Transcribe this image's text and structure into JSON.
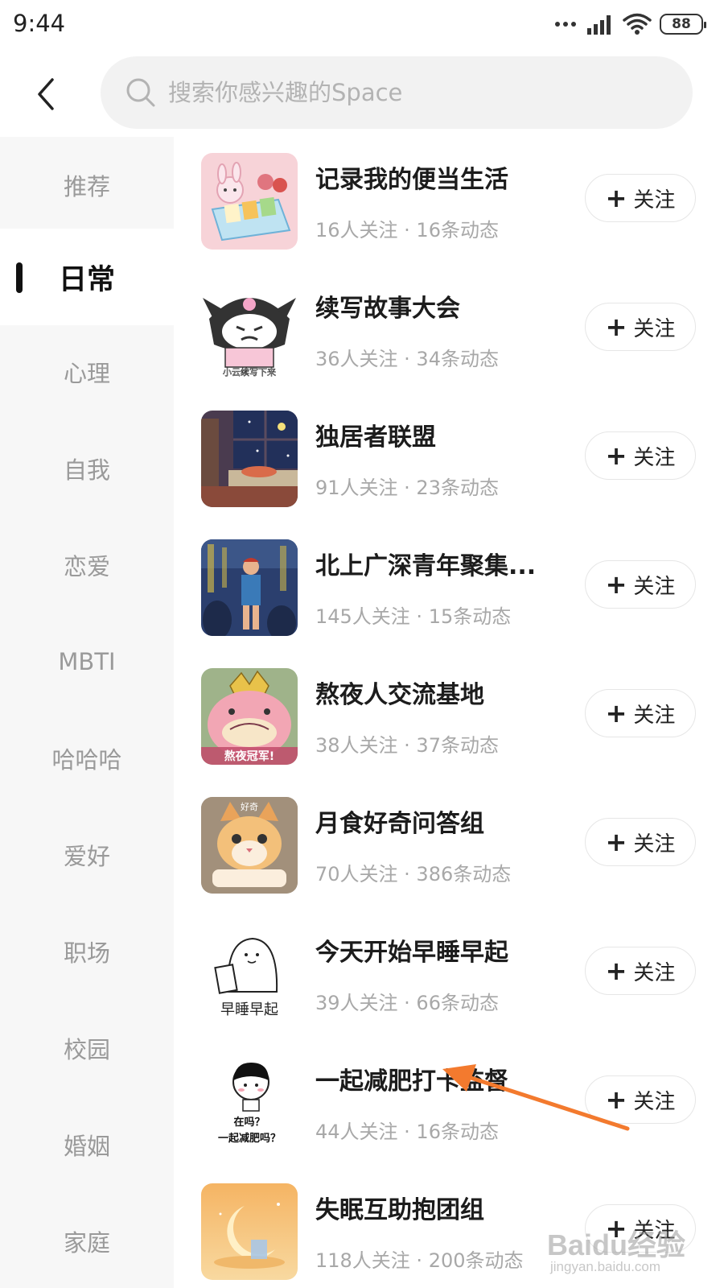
{
  "status_bar": {
    "time": "9:44",
    "battery": "88",
    "icons": [
      "signal-dots-icon",
      "cellular-signal-icon",
      "wifi-icon",
      "battery-icon"
    ]
  },
  "header": {
    "back_icon": "chevron-left-icon",
    "search_icon": "search-icon",
    "search_placeholder": "搜索你感兴趣的Space"
  },
  "sidebar": {
    "items": [
      {
        "label": "推荐",
        "active": false
      },
      {
        "label": "日常",
        "active": true
      },
      {
        "label": "心理",
        "active": false
      },
      {
        "label": "自我",
        "active": false
      },
      {
        "label": "恋爱",
        "active": false
      },
      {
        "label": "MBTI",
        "active": false
      },
      {
        "label": "哈哈哈",
        "active": false
      },
      {
        "label": "爱好",
        "active": false
      },
      {
        "label": "职场",
        "active": false
      },
      {
        "label": "校园",
        "active": false
      },
      {
        "label": "婚姻",
        "active": false
      },
      {
        "label": "家庭",
        "active": false
      }
    ]
  },
  "follow_label": "关注",
  "spaces": [
    {
      "title": "记录我的便当生活",
      "meta": "16人关注 · 16条动态"
    },
    {
      "title": "续写故事大会",
      "meta": "36人关注 · 34条动态",
      "image_text": "小云续写下来"
    },
    {
      "title": "独居者联盟",
      "meta": "91人关注 · 23条动态"
    },
    {
      "title": "北上广深青年聚集...",
      "meta": "145人关注 · 15条动态"
    },
    {
      "title": "熬夜人交流基地",
      "meta": "38人关注 · 37条动态",
      "image_text": "熬夜冠军!"
    },
    {
      "title": "月食好奇问答组",
      "meta": "70人关注 · 386条动态",
      "image_text": "好奇"
    },
    {
      "title": "今天开始早睡早起",
      "meta": "39人关注 · 66条动态",
      "image_text": "早睡早起"
    },
    {
      "title": "一起减肥打卡监督",
      "meta": "44人关注 · 16条动态",
      "image_text_1": "在吗？",
      "image_text_2": "一起减肥吗？"
    },
    {
      "title": "失眠互助抱团组",
      "meta": "118人关注 · 200条动态"
    }
  ],
  "annotation": {
    "color": "#f37a2e"
  },
  "watermark": {
    "main": "Baidu经验",
    "sub": "jingyan.baidu.com"
  }
}
